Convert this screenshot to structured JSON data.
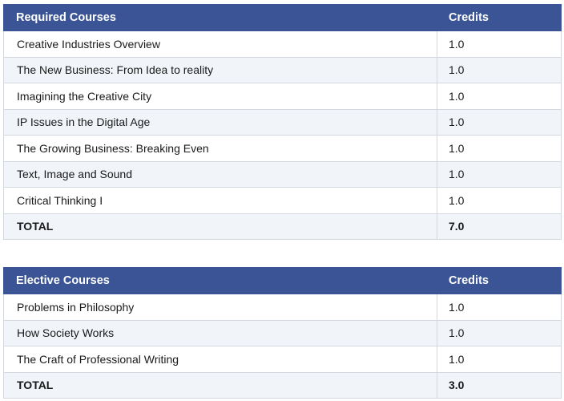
{
  "required": {
    "header": {
      "name": "Required Courses",
      "credits": "Credits"
    },
    "rows": [
      {
        "name": "Creative Industries Overview",
        "credits": "1.0"
      },
      {
        "name": "The New Business: From Idea to reality",
        "credits": "1.0"
      },
      {
        "name": "Imagining the Creative City",
        "credits": "1.0"
      },
      {
        "name": "IP Issues in the Digital Age",
        "credits": "1.0"
      },
      {
        "name": "The Growing Business: Breaking Even",
        "credits": "1.0"
      },
      {
        "name": "Text, Image and Sound",
        "credits": "1.0"
      },
      {
        "name": "Critical Thinking I",
        "credits": "1.0"
      }
    ],
    "total": {
      "name": "TOTAL",
      "credits": "7.0"
    }
  },
  "elective": {
    "header": {
      "name": "Elective Courses",
      "credits": "Credits"
    },
    "rows": [
      {
        "name": "Problems in Philosophy",
        "credits": "1.0"
      },
      {
        "name": "How Society Works",
        "credits": "1.0"
      },
      {
        "name": "The Craft of Professional Writing",
        "credits": "1.0"
      }
    ],
    "total": {
      "name": "TOTAL",
      "credits": "3.0"
    }
  },
  "colors": {
    "header_bg": "#3a5495",
    "stripe_bg": "#f1f4f9",
    "border": "#d3d7de"
  }
}
